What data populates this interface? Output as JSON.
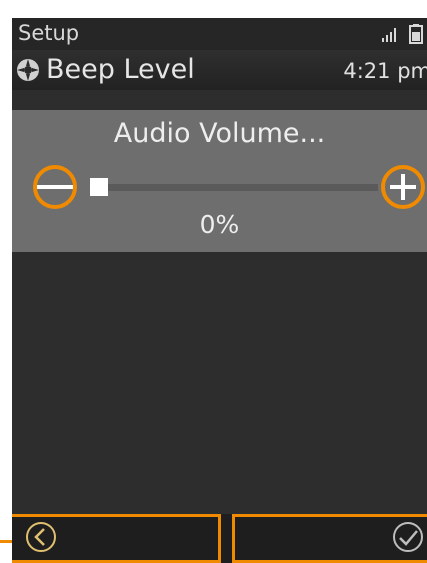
{
  "status_bar": {
    "app_title": "Setup",
    "signal_icon": "signal-bars-icon",
    "battery_icon": "battery-icon"
  },
  "title_bar": {
    "icon": "settings-icon",
    "title": "Beep Level",
    "time": "4:21 pm"
  },
  "volume": {
    "label": "Audio Volume...",
    "value_text": "0%",
    "level_percent": 0,
    "minus_icon": "minus-icon",
    "plus_icon": "plus-icon"
  },
  "softkeys": {
    "back_icon": "chevron-left-icon",
    "ok_icon": "checkmark-icon"
  },
  "colors": {
    "highlight": "#f08a00",
    "panel": "#6e6e6e",
    "background": "#2d2d2d",
    "text": "#eeeeee"
  }
}
